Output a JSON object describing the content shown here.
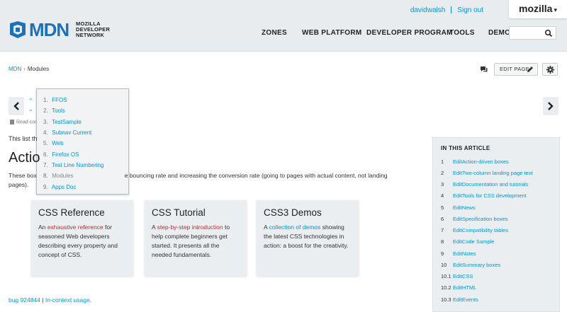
{
  "header": {
    "logo_text": "MDN",
    "logo_sub": [
      "MOZILLA",
      "DEVELOPER",
      "NETWORK"
    ],
    "user": "davidwalsh",
    "sign_out": "Sign out",
    "mozilla_tab": "mozilla",
    "nav": [
      "ZONES",
      "WEB PLATFORM",
      "DEVELOPER PROGRAM",
      "TOOLS",
      "DEMOS"
    ],
    "search_placeholder": ""
  },
  "breadcrumb": {
    "root": "MDN",
    "sep": "›",
    "current": "Modules"
  },
  "toolbar": {
    "edit_label": "EDIT PAGE"
  },
  "read_contrib": "Read con",
  "dropdown": [
    {
      "num": "1.",
      "label": "FFOS",
      "current": false
    },
    {
      "num": "2.",
      "label": "Tools",
      "current": false
    },
    {
      "num": "3.",
      "label": "TestSample",
      "current": false
    },
    {
      "num": "4.",
      "label": "Subnav Current",
      "current": false
    },
    {
      "num": "5.",
      "label": "Web",
      "current": false
    },
    {
      "num": "6.",
      "label": "Firefox OS",
      "current": false
    },
    {
      "num": "7.",
      "label": "Test Line Numbering",
      "current": false
    },
    {
      "num": "8.",
      "label": "Modules",
      "current": true
    },
    {
      "num": "9.",
      "label": "Apps Doc",
      "current": false
    }
  ],
  "main": {
    "intro": "This list th",
    "heading": "Actio",
    "para_start": "These box",
    "para_rest": "e bouncing rate and increasing the conversion rate (going to pages with actual content, not landing",
    "para_end": "pages)."
  },
  "cards": [
    {
      "title": "CSS Reference",
      "pre": "An ",
      "link": "exhaustive reference",
      "post": " for seasoned Web developers describing every property and concept of CSS."
    },
    {
      "title": "CSS Tutorial",
      "pre": "A ",
      "link": "step-by-step introduction",
      "post": " to help complete beginners get started. It presents all the needed fundamentals."
    },
    {
      "title": "CSS3 Demos",
      "pre": "A ",
      "link": "collection of demos",
      "post": " showing the latest CSS technologies in action: a boost for the creativity."
    }
  ],
  "footer": {
    "bug": "bug 924844",
    "sep": " | ",
    "usage": "In-context usage",
    "end": "."
  },
  "toc": {
    "title": "IN THIS ARTICLE",
    "items": [
      {
        "num": "1",
        "label": "EditAction-driven boxes"
      },
      {
        "num": "2",
        "label": "EditTwo-column landing page text"
      },
      {
        "num": "3",
        "label": "EditDocumentation and tutorials"
      },
      {
        "num": "4",
        "label": "EditTools for CSS development"
      },
      {
        "num": "5",
        "label": "EditNews"
      },
      {
        "num": "6",
        "label": "EditSpecification boxes"
      },
      {
        "num": "7",
        "label": "EditCompatibility tables"
      },
      {
        "num": "8",
        "label": "EditCode Sample"
      },
      {
        "num": "9",
        "label": "EditNotes"
      },
      {
        "num": "10",
        "label": "EditSummary boxes"
      },
      {
        "num": "10.1",
        "label": "EditCSS"
      },
      {
        "num": "10.2",
        "label": "EditHTML"
      },
      {
        "num": "10.3",
        "label": "EditEvents"
      }
    ]
  },
  "colors": {
    "link": "#0095dd",
    "brand": "#1b72b8",
    "highlight": "#c72b2b"
  }
}
